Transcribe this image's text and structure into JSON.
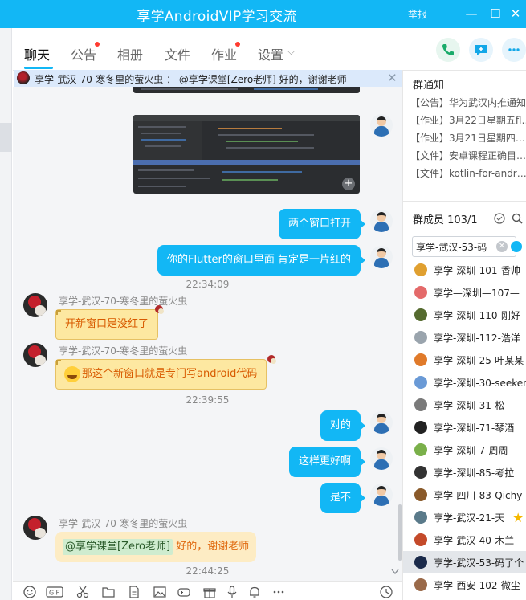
{
  "window": {
    "title": "享学AndroidVIP学习交流",
    "report": "举报",
    "minimize": "—",
    "maximize": "☐",
    "close": "✕"
  },
  "tabs": [
    {
      "label": "聊天",
      "active": true,
      "dot": false
    },
    {
      "label": "公告",
      "active": false,
      "dot": true
    },
    {
      "label": "相册",
      "active": false,
      "dot": false
    },
    {
      "label": "文件",
      "active": false,
      "dot": false
    },
    {
      "label": "作业",
      "active": false,
      "dot": true
    },
    {
      "label": "设置",
      "active": false,
      "dot": false
    }
  ],
  "settings_chevron": "⌵",
  "pinned": {
    "text": "享学-武汉-70-寒冬里的萤火虫 ： @享学课堂[Zero老师] 好的，谢谢老师",
    "close": "✕"
  },
  "messages": [
    {
      "type": "out",
      "text": "两个窗口打开"
    },
    {
      "type": "out",
      "text": "你的Flutter的窗口里面 肯定是一片红的"
    },
    {
      "type": "time",
      "text": "22:34:09"
    },
    {
      "type": "in",
      "sender": "享学-武汉-70-寒冬里的萤火虫",
      "text": "开新窗口是没红了"
    },
    {
      "type": "in",
      "sender": "享学-武汉-70-寒冬里的萤火虫",
      "text": "那这个新窗口就是专门写android代码"
    },
    {
      "type": "time",
      "text": "22:39:55"
    },
    {
      "type": "out",
      "text": "对的"
    },
    {
      "type": "out",
      "text": "这样更好啊"
    },
    {
      "type": "out",
      "text": "是不"
    },
    {
      "type": "in",
      "sender": "享学-武汉-70-寒冬里的萤火虫",
      "mention": "@享学课堂[Zero老师]",
      "text": " 好的，谢谢老师"
    },
    {
      "type": "time",
      "text": "22:44:25"
    }
  ],
  "right_panel": {
    "notice_title": "群通知",
    "notices": [
      "【公告】华为武汉内推通知",
      "【作业】3月22日星期五fl…",
      "【作业】3月21日星期四…",
      "【文件】安卓课程正确目…",
      "【文件】kotlin-for-andr…"
    ],
    "members_title": "群成员 103/1",
    "search_value": "享学-武汉-53-码",
    "members": [
      {
        "name": "享学-深圳-101-香帅",
        "color": "#e0a030"
      },
      {
        "name": "享学—深圳—107—",
        "color": "#e46a6a"
      },
      {
        "name": "享学-深圳-110-刚好",
        "color": "#556b2f"
      },
      {
        "name": "享学-深圳-112-浩洋",
        "color": "#9aa4ad"
      },
      {
        "name": "享学-深圳-25-叶某某",
        "color": "#e07a2a"
      },
      {
        "name": "享学-深圳-30-seeker",
        "color": "#6a9ad6"
      },
      {
        "name": "享学-深圳-31-松",
        "color": "#7a7a7a"
      },
      {
        "name": "享学-深圳-71-琴酒",
        "color": "#222222"
      },
      {
        "name": "享学-深圳-7-周周",
        "color": "#7ab04a"
      },
      {
        "name": "享学-深圳-85-考拉",
        "color": "#333333"
      },
      {
        "name": "享学-四川-83-Qichy",
        "color": "#8a5a2a"
      },
      {
        "name": "享学-武汉-21-天",
        "color": "#5a7a8a",
        "star": true
      },
      {
        "name": "享学-武汉-40-木兰",
        "color": "#c44a2a"
      },
      {
        "name": "享学-武汉-53-码了个",
        "color": "#1a2a4a",
        "selected": true
      },
      {
        "name": "享学-西安-102-微尘",
        "color": "#9a6a4a"
      }
    ]
  },
  "toolbar_icons": [
    "emoji-icon",
    "gif-icon",
    "scissors-icon",
    "folder-icon",
    "document-icon",
    "image-icon",
    "game-icon",
    "gift-icon",
    "bell-icon",
    "more-icon",
    "history-icon"
  ]
}
